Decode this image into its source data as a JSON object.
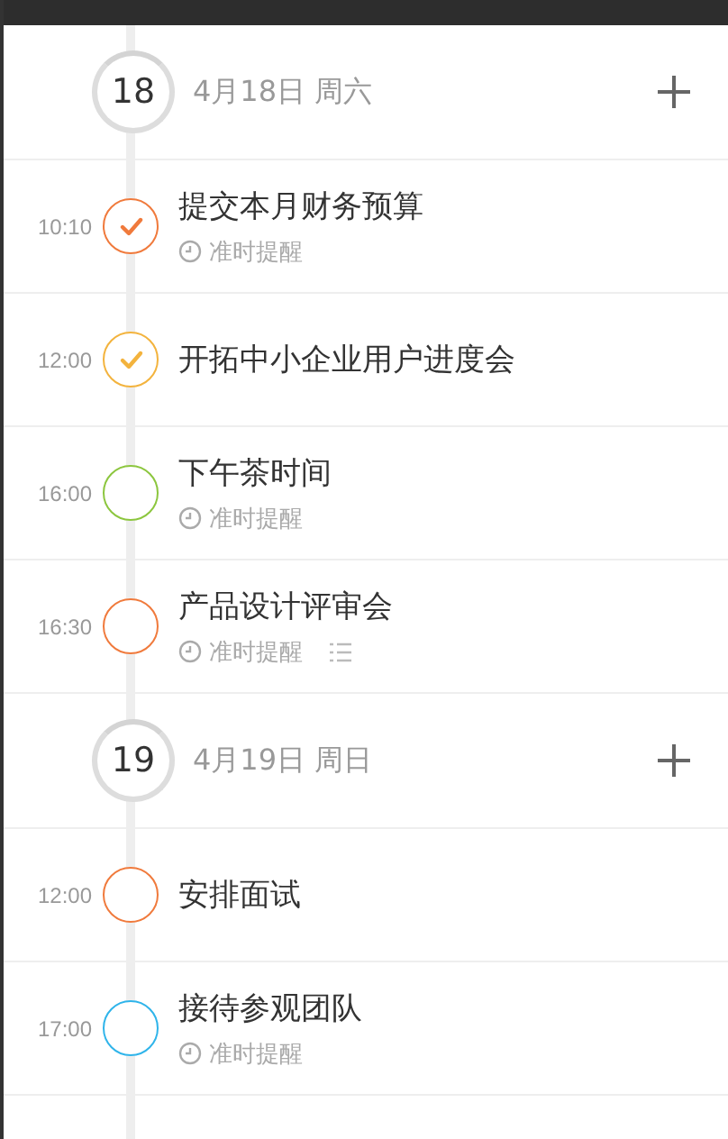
{
  "days": [
    {
      "badge": "18",
      "date": "4月18日 周六",
      "items": [
        {
          "time": "10:10",
          "title": "提交本月财务预算",
          "color": "#f07a3c",
          "checked": true,
          "reminder": "准时提醒",
          "notes": false
        },
        {
          "time": "12:00",
          "title": "开拓中小企业用户进度会",
          "color": "#f3b33d",
          "checked": true,
          "notes": false
        },
        {
          "time": "16:00",
          "title": "下午茶时间",
          "color": "#8cc63e",
          "checked": false,
          "reminder": "准时提醒",
          "notes": false
        },
        {
          "time": "16:30",
          "title": "产品设计评审会",
          "color": "#f07a3c",
          "checked": false,
          "reminder": "准时提醒",
          "notes": true
        }
      ]
    },
    {
      "badge": "19",
      "date": "4月19日 周日",
      "items": [
        {
          "time": "12:00",
          "title": "安排面试",
          "color": "#f07a3c",
          "checked": false,
          "notes": false
        },
        {
          "time": "17:00",
          "title": "接待参观团队",
          "color": "#2fb4ea",
          "checked": false,
          "reminder": "准时提醒",
          "notes": false
        }
      ]
    }
  ]
}
